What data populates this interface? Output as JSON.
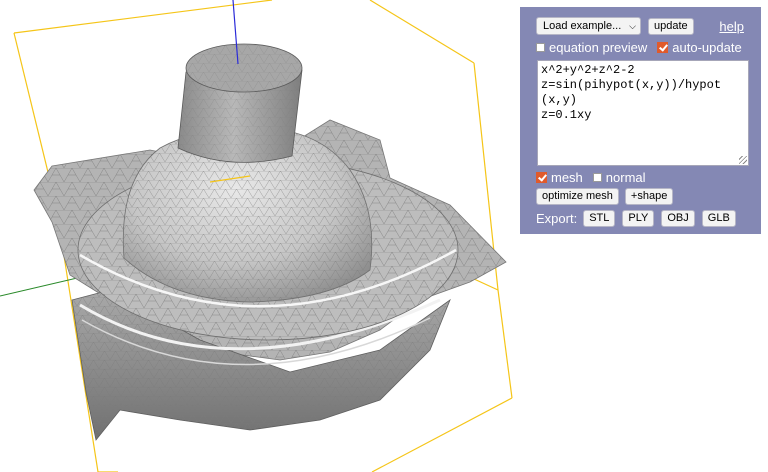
{
  "controls": {
    "load_select": "Load example...",
    "update_label": "update",
    "help_link": "help",
    "equation_preview": {
      "label": "equation preview",
      "checked": false
    },
    "auto_update": {
      "label": "auto-update",
      "checked": true
    },
    "editor_lines": [
      "x^2+y^2+z^2-2",
      "z=sin(pihypot(x,y))/hypot",
      "(x,y)",
      "z=0.1xy"
    ],
    "mesh": {
      "label": "mesh",
      "checked": true
    },
    "normal": {
      "label": "normal",
      "checked": false
    },
    "optimize_label": "optimize mesh",
    "shape_label": "+shape",
    "export_label": "Export:",
    "export_buttons": [
      "STL",
      "PLY",
      "OBJ",
      "GLB"
    ]
  },
  "colors": {
    "panel_bg": "#8488b4",
    "bounding_box": "#f5c518",
    "axis_y": "#2a2ad8",
    "axis_x": "#2a8a2a",
    "checkbox_on": "#e05a2b",
    "surface": "#c4c4c4"
  }
}
